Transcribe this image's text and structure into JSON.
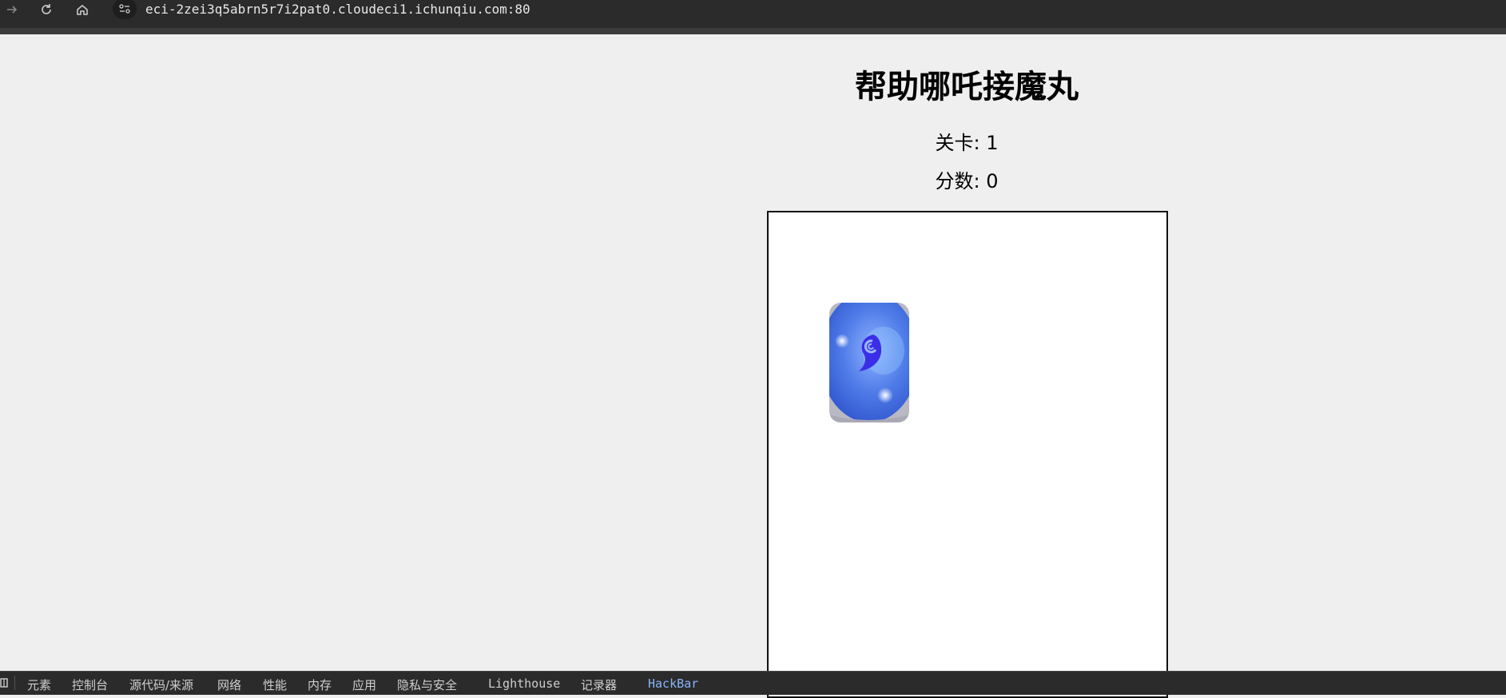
{
  "browser": {
    "url": "eci-2zei3q5abrn5r7i2pat0.cloudeci1.ichunqiu.com:80",
    "icons": [
      "forward-icon",
      "reload-icon",
      "home-icon",
      "site-settings-icon"
    ]
  },
  "game": {
    "title": "帮助哪吒接魔丸",
    "level_label": "关卡: 1",
    "score_label": "分数: 0",
    "orb_colors": {
      "outer": "#3a5ee0",
      "inner": "#5b86f2",
      "swirl": "#3b2ee8",
      "glow": "#ffffff"
    }
  },
  "devtools": {
    "tabs": [
      "元素",
      "控制台",
      "源代码/来源",
      "网络",
      "性能",
      "内存",
      "应用",
      "隐私与安全",
      "Lighthouse",
      "记录器",
      "HackBar"
    ],
    "active_tab": "HackBar",
    "active_color": "#8ab4f8"
  }
}
